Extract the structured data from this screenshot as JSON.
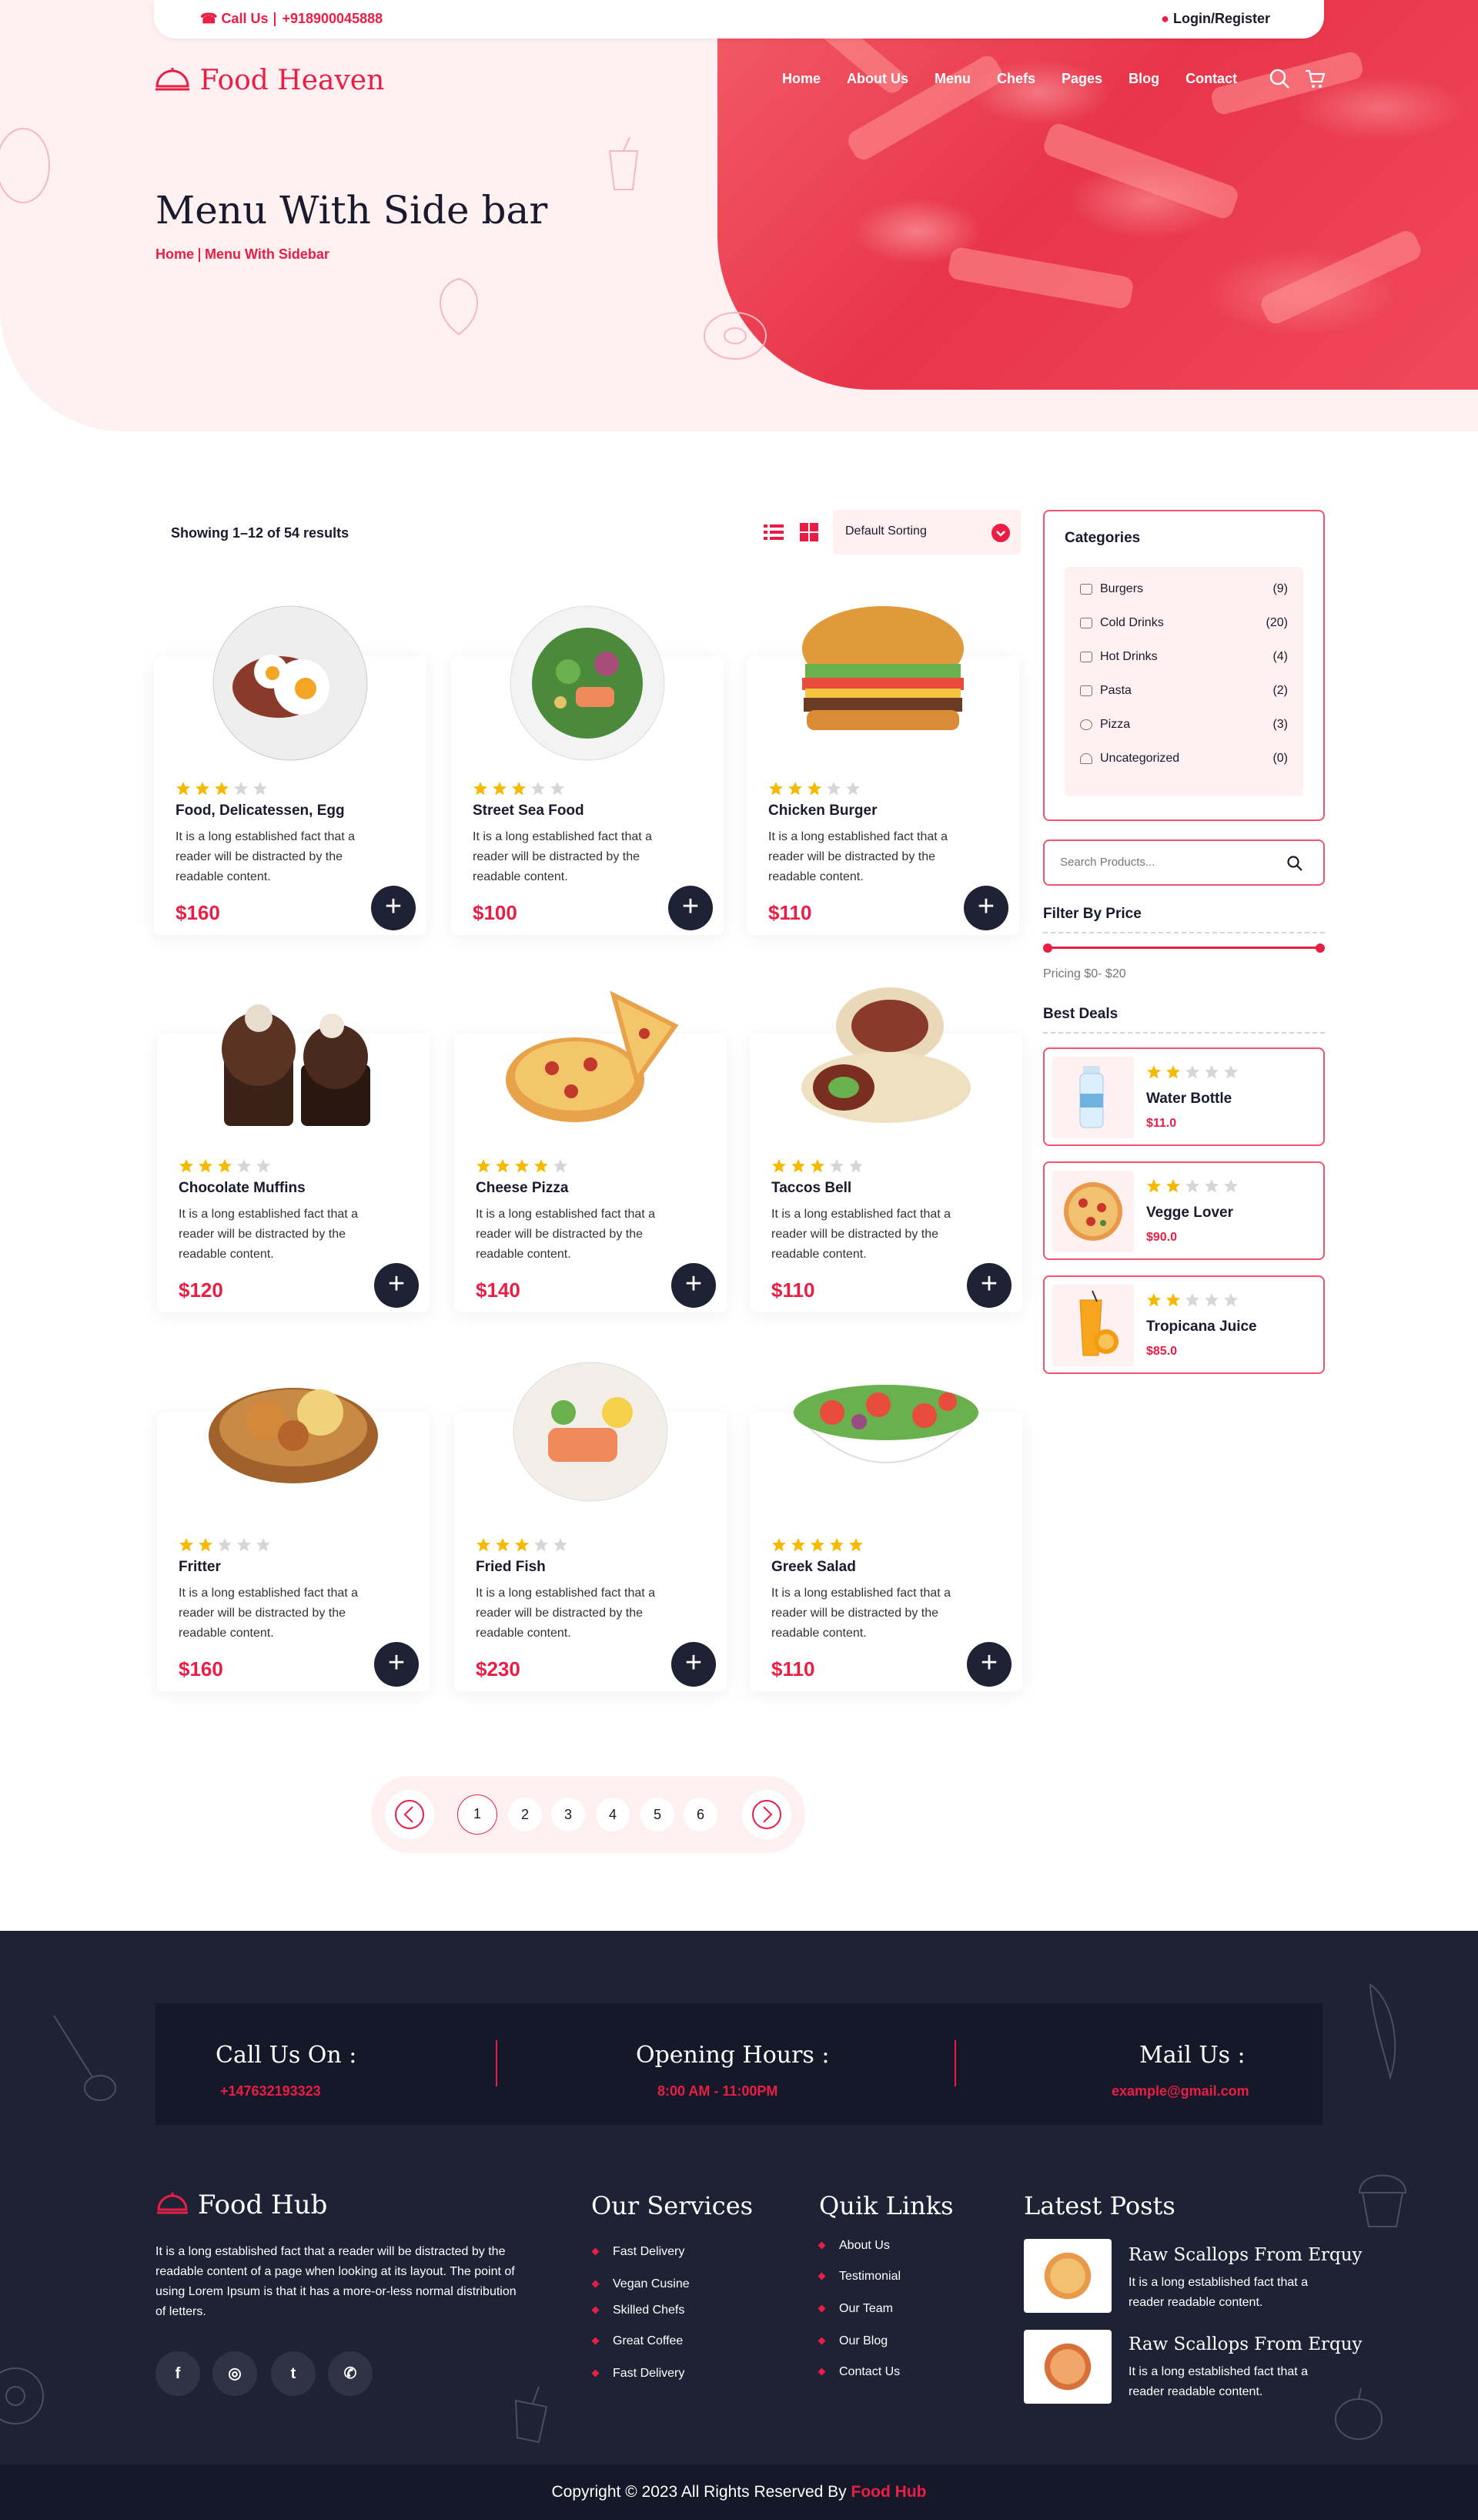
{
  "topbar": {
    "call_label": "Call Us",
    "phone": "+918900045888",
    "login": "Login/Register"
  },
  "brand": {
    "name": "Food Heaven"
  },
  "nav": [
    "Home",
    "About Us",
    "Menu",
    "Chefs",
    "Pages",
    "Blog",
    "Contact"
  ],
  "hero": {
    "title": "Menu With Side bar",
    "crumb_home": "Home",
    "crumb_current": "Menu With Sidebar"
  },
  "toolbar": {
    "results": "Showing 1–12 of 54 results",
    "sort": "Default Sorting"
  },
  "products": [
    {
      "name": "Food, Delicatessen, Egg",
      "desc": "It is a long established fact that a reader will be distracted by the readable content.",
      "price": "$160",
      "rating": 3
    },
    {
      "name": "Street Sea Food",
      "desc": "It is a long established fact that a reader will be distracted by the readable content.",
      "price": "$100",
      "rating": 3
    },
    {
      "name": "Chicken Burger",
      "desc": "It is a long established fact that a reader will be distracted by the readable content.",
      "price": "$110",
      "rating": 3
    },
    {
      "name": "Chocolate Muffins",
      "desc": "It is a long established fact that a reader will be distracted by the readable content.",
      "price": "$120",
      "rating": 3
    },
    {
      "name": "Cheese Pizza",
      "desc": "It is a long established fact that a reader will be distracted by the readable content.",
      "price": "$140",
      "rating": 4
    },
    {
      "name": "Taccos Bell",
      "desc": "It is a long established fact that a reader will be distracted by the readable content.",
      "price": "$110",
      "rating": 3
    },
    {
      "name": "Fritter",
      "desc": "It is a long established fact that a reader will be distracted by the readable content.",
      "price": "$160",
      "rating": 2
    },
    {
      "name": "Fried Fish",
      "desc": "It is a long established fact that a reader will be distracted by the readable content.",
      "price": "$230",
      "rating": 3
    },
    {
      "name": "Greek Salad",
      "desc": "It is a long established fact that a reader will be distracted by the readable content.",
      "price": "$110",
      "rating": 5
    }
  ],
  "sidebar": {
    "categories_title": "Categories",
    "categories": [
      {
        "name": "Burgers",
        "count": "(9)"
      },
      {
        "name": "Cold Drinks",
        "count": "(20)"
      },
      {
        "name": "Hot Drinks",
        "count": "(4)"
      },
      {
        "name": "Pasta",
        "count": "(2)"
      },
      {
        "name": "Pizza",
        "count": "(3)"
      },
      {
        "name": "Uncategorized",
        "count": "(0)"
      }
    ],
    "search_placeholder": "Search Products...",
    "filter_title": "Filter By Price",
    "pricing": "Pricing $0- $20",
    "deals_title": "Best Deals",
    "deals": [
      {
        "name": "Water Bottle",
        "price": "$11.0",
        "rating": 2
      },
      {
        "name": "Vegge Lover",
        "price": "$90.0",
        "rating": 2
      },
      {
        "name": "Tropicana Juice",
        "price": "$85.0",
        "rating": 2
      }
    ]
  },
  "pagination": {
    "pages": [
      "1",
      "2",
      "3",
      "4",
      "5",
      "6"
    ],
    "current": "1"
  },
  "footer": {
    "call_title": "Call Us On :",
    "call_value": "+147632193323",
    "hours_title": "Opening Hours :",
    "hours_value": "8:00 AM - 11:00PM",
    "mail_title": "Mail Us :",
    "mail_value": "example@gmail.com",
    "brand": "Food Hub",
    "about": "It is a long established fact that a reader will be distracted by the readable content of a page when looking at its layout. The point of using Lorem Ipsum is that it has a more-or-less normal distribution of letters.",
    "services_title": "Our Services",
    "services": [
      "Fast Delivery",
      "Vegan Cusine",
      "Skilled Chefs",
      "Great Coffee",
      "Fast Delivery"
    ],
    "links_title": "Quik Links",
    "links": [
      "About Us",
      "Testimonial",
      "Our Team",
      "Our Blog",
      "Contact Us"
    ],
    "posts_title": "Latest Posts",
    "posts": [
      {
        "title": "Raw Scallops From Erquy",
        "text": "It is a long established fact that a reader readable content."
      },
      {
        "title": "Raw Scallops From Erquy",
        "text": "It is a long established fact that a reader readable content."
      }
    ],
    "copyright_prefix": "Copyright © 2023 All Rights Reserved By",
    "copyright_brand": "Food Hub"
  },
  "colors": {
    "accent": "#ea1e45",
    "dark": "#1e2235",
    "pink_bg": "#fff0f1",
    "star": "#f5b900"
  }
}
